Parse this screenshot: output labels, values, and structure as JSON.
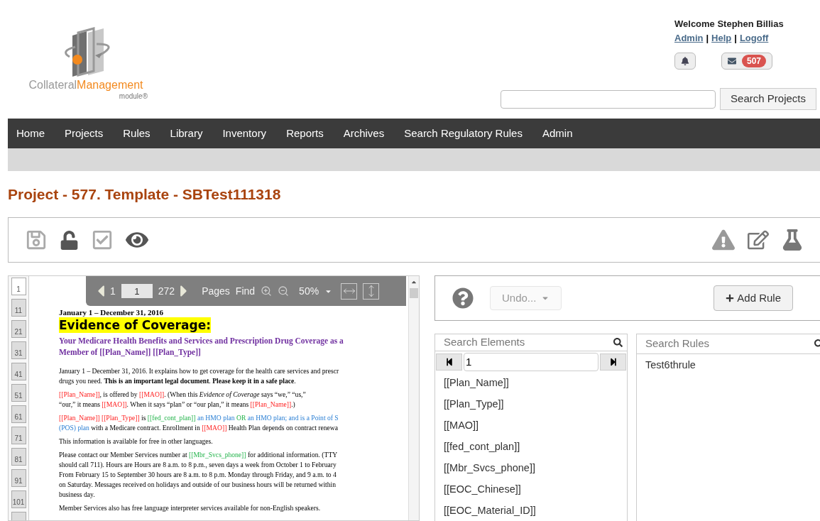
{
  "header": {
    "logo": {
      "word_1": "Collateral",
      "word_2": "Management",
      "word_3": "module",
      "mark": "®"
    },
    "welcome": "Welcome Stephen Billias",
    "user_links": [
      {
        "label": "Admin"
      },
      {
        "label": "Help"
      },
      {
        "label": "Logoff"
      }
    ],
    "link_separator": "|",
    "message_count": "507",
    "search_button": "Search Projects"
  },
  "nav": [
    {
      "label": "Home"
    },
    {
      "label": "Projects"
    },
    {
      "label": "Rules"
    },
    {
      "label": "Library"
    },
    {
      "label": "Inventory"
    },
    {
      "label": "Reports"
    },
    {
      "label": "Archives"
    },
    {
      "label": "Search Regulatory Rules"
    },
    {
      "label": "Admin"
    }
  ],
  "page_title": "Project - 577. Template - SBTest111318",
  "viewer": {
    "thumbnails": [
      {
        "label": "1",
        "selected": true
      },
      {
        "label": "11",
        "selected": false
      },
      {
        "label": "21",
        "selected": false
      },
      {
        "label": "31",
        "selected": false
      },
      {
        "label": "41",
        "selected": false
      },
      {
        "label": "51",
        "selected": false
      },
      {
        "label": "61",
        "selected": false
      },
      {
        "label": "71",
        "selected": false
      },
      {
        "label": "81",
        "selected": false
      },
      {
        "label": "91",
        "selected": false
      },
      {
        "label": "101",
        "selected": false
      }
    ],
    "toolbar": {
      "first_page": "1",
      "current_page": "1",
      "page_count": "272",
      "pages": "Pages",
      "find": "Find",
      "zoom": "50%"
    },
    "document": {
      "date_line": "January 1 – December 31, 2016",
      "title": "Evidence of Coverage:",
      "subtitle": [
        "Your Medicare Health Benefits and Services and Prescription Drug Coverage as a",
        "Member of [[Plan_Name]] [[Plan_Type]]"
      ],
      "paragraphs": [
        [
          [
            {
              "kind": "plain",
              "text": "January 1 – December 31, 2016. It explains how to get coverage for the health care services and prescr"
            }
          ],
          [
            {
              "kind": "plain",
              "text": "drugs you need. **This is an important legal document**. **Please keep it in a safe place**."
            }
          ]
        ],
        [
          [
            {
              "kind": "field",
              "text": "[[Plan_Name]]"
            },
            {
              "kind": "plain",
              "text": ", is offered by "
            },
            {
              "kind": "field",
              "text": "[[MAO]]"
            },
            {
              "kind": "plain",
              "text": ". (When this *Evidence of Coverage* says “we,” “us,”"
            }
          ],
          [
            {
              "kind": "plain",
              "text": "“our,” it means "
            },
            {
              "kind": "field",
              "text": "[[MAO]]"
            },
            {
              "kind": "plain",
              "text": ". When it says “plan” or “our plan,” it means "
            },
            {
              "kind": "field",
              "text": "[[Plan_Name]]"
            },
            {
              "kind": "plain",
              "text": ".)"
            }
          ]
        ],
        [
          [
            {
              "kind": "field",
              "text": "[[Plan_Name]] [[Plan_Type]]"
            },
            {
              "kind": "plain",
              "text": " is "
            },
            {
              "kind": "condition",
              "text": "[[fed_cont_plan]]"
            },
            {
              "kind": "option",
              "text": " an HMO plan "
            },
            {
              "kind": "condition",
              "text": "OR"
            },
            {
              "kind": "option",
              "text": " an HMO plan; and is a Point of S"
            }
          ],
          [
            {
              "kind": "option",
              "text": "(POS) plan"
            },
            {
              "kind": "plain",
              "text": " with a Medicare contract. Enrollment in "
            },
            {
              "kind": "field",
              "text": "[[MAO]]"
            },
            {
              "kind": "plain",
              "text": " Health Plan depends on contract renewa"
            }
          ]
        ],
        [
          [
            {
              "kind": "plain",
              "text": "This information is available for free in other languages."
            }
          ]
        ],
        [
          [
            {
              "kind": "plain",
              "text": "Please contact our Member Services number at "
            },
            {
              "kind": "condition",
              "text": "[[Mbr_Svcs_phone]]"
            },
            {
              "kind": "plain",
              "text": " for additional information. (TTY"
            }
          ],
          [
            {
              "kind": "plain",
              "text": "should call 711). Hours are Hours are 8 a.m. to 8 p.m., seven days a week from October 1 to February"
            }
          ],
          [
            {
              "kind": "plain",
              "text": "From February 15 to September 30 hours are 8 a.m. to 8 p.m. Monday through Friday, and 9 a.m. to 4"
            }
          ],
          [
            {
              "kind": "plain",
              "text": "on Saturday. Messages received on holidays and outside of our business hours will be returned within"
            }
          ],
          [
            {
              "kind": "plain",
              "text": "business day."
            }
          ]
        ],
        [
          [
            {
              "kind": "plain",
              "text": "Member Services also has free language interpreter services available for non-English speakers."
            }
          ]
        ]
      ]
    }
  },
  "rules_panel": {
    "undo": {
      "label": "Undo...",
      "disabled": true
    },
    "add_rule": "Add Rule",
    "elements": {
      "placeholder": "Search Elements",
      "page": "1",
      "items": [
        "[[Plan_Name]]",
        "[[Plan_Type]]",
        "[[MAO]]",
        "[[fed_cont_plan]]",
        "[[Mbr_Svcs_phone]]",
        "[[EOC_Chinese]]",
        "[[EOC_Material_ID]]"
      ]
    },
    "rules": {
      "placeholder": "Search Rules",
      "items": [
        "Test6thrule"
      ]
    }
  }
}
